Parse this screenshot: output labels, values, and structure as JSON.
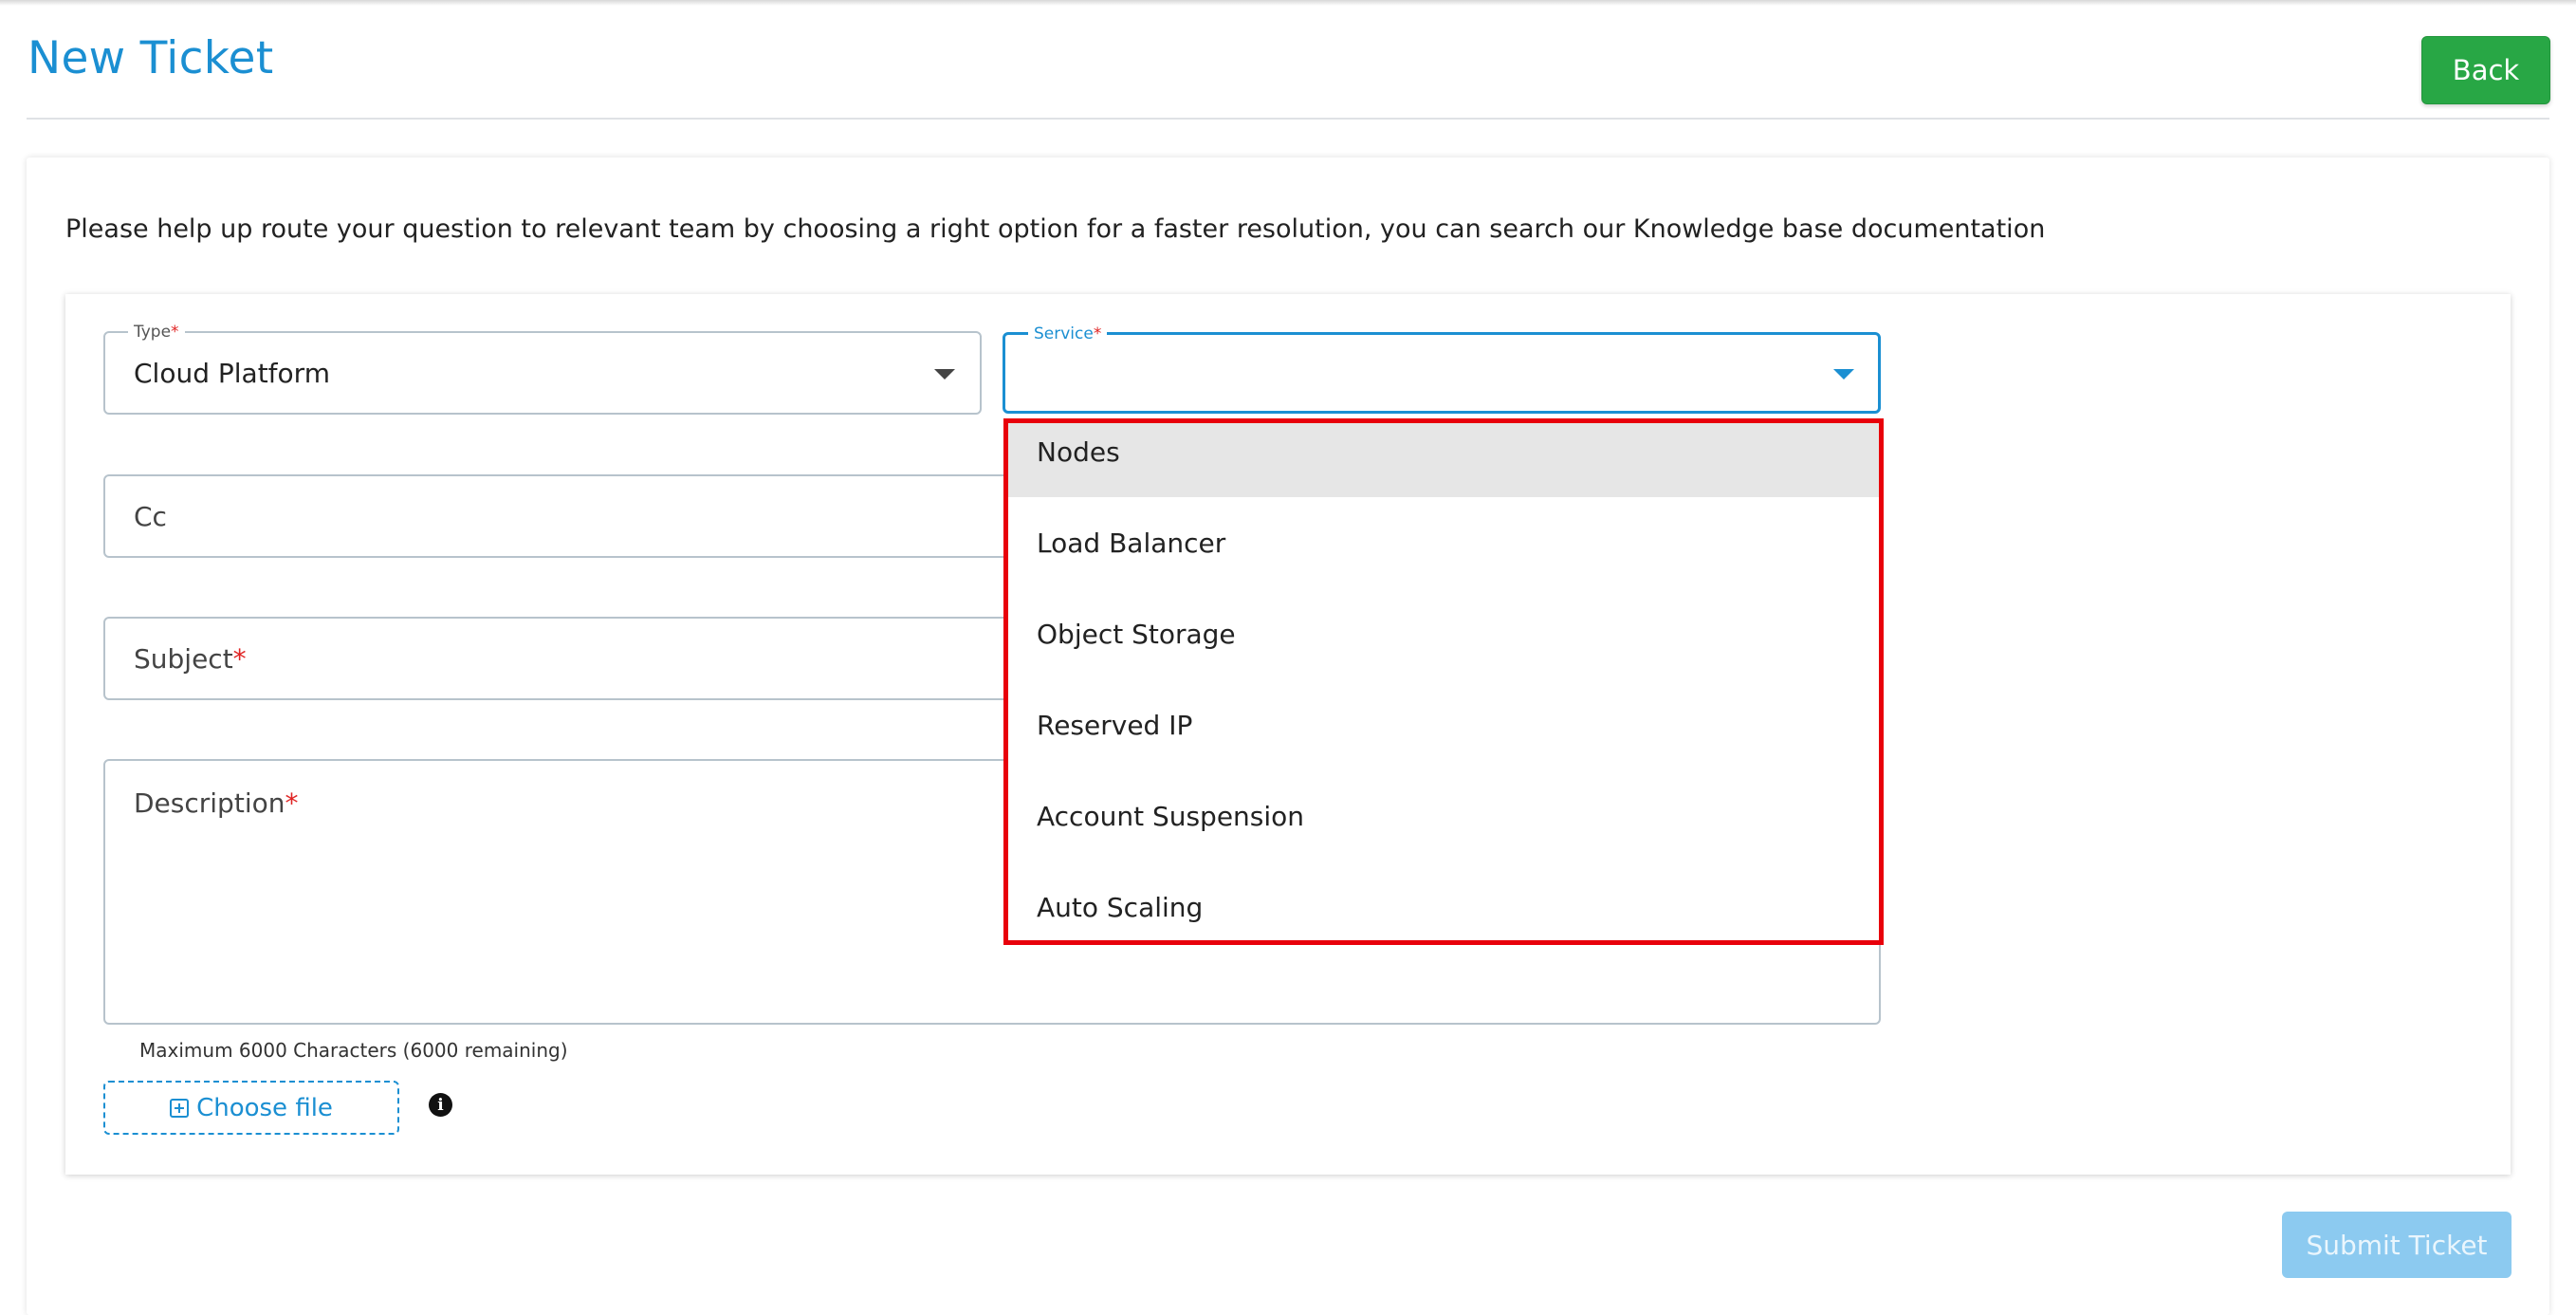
{
  "header": {
    "title": "New Ticket",
    "back_label": "Back"
  },
  "intro": "Please help up route your question to relevant team by choosing a right option for a faster resolution, you can search our Knowledge base documentation",
  "form": {
    "type": {
      "label": "Type",
      "required_mark": "*",
      "value": "Cloud Platform"
    },
    "service": {
      "label": "Service",
      "required_mark": "*",
      "value": ""
    },
    "cc": {
      "placeholder": "Cc"
    },
    "subject": {
      "placeholder": "Subject",
      "required_mark": "*"
    },
    "description": {
      "placeholder": "Description",
      "required_mark": "*"
    },
    "char_note": "Maximum 6000 Characters (6000 remaining)",
    "choose_file_label": "Choose file",
    "info_glyph": "i",
    "submit_label": "Submit Ticket"
  },
  "service_dropdown": {
    "options": [
      "Nodes",
      "Load Balancer",
      "Object Storage",
      "Reserved IP",
      "Account Suspension",
      "Auto Scaling"
    ],
    "highlighted": "Nodes"
  },
  "colors": {
    "accent": "#1b8fd2",
    "back_button": "#28a745",
    "submit_disabled": "#8ccaf0",
    "dropdown_outline": "#e8000b"
  }
}
